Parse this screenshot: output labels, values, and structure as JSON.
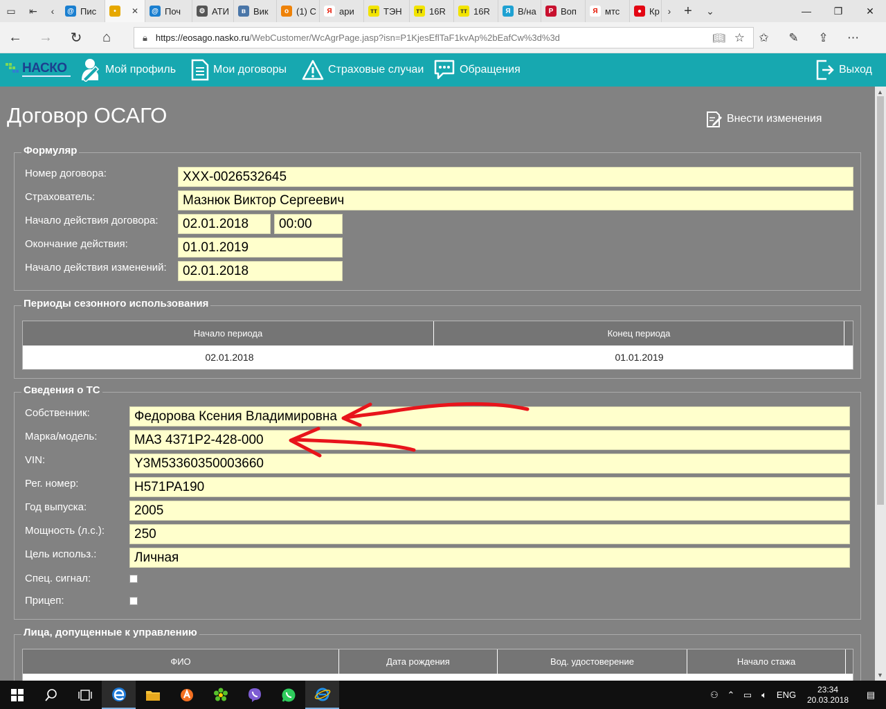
{
  "browser": {
    "tabs": [
      {
        "label": "Пис",
        "color": "#1a7fd0",
        "glyph": "@"
      },
      {
        "label": "",
        "color": "#e6a800",
        "glyph": "•",
        "active": true
      },
      {
        "label": "Поч",
        "color": "#1a7fd0",
        "glyph": "@"
      },
      {
        "label": "АТИ",
        "color": "#555555",
        "glyph": "⚙"
      },
      {
        "label": "Вик",
        "color": "#4a76a8",
        "glyph": "в"
      },
      {
        "label": "(1) С",
        "color": "#ee8208",
        "glyph": "о"
      },
      {
        "label": "ари",
        "color": "#ffffff",
        "glyph": "Я",
        "fg": "#e61400"
      },
      {
        "label": "ТЭН",
        "color": "#f2e400",
        "glyph": "тт",
        "fg": "#333"
      },
      {
        "label": "16R",
        "color": "#f2e400",
        "glyph": "тт",
        "fg": "#333"
      },
      {
        "label": "16R",
        "color": "#f2e400",
        "glyph": "тт",
        "fg": "#333"
      },
      {
        "label": "В/на",
        "color": "#1ea1d2",
        "glyph": "Я"
      },
      {
        "label": "Воп",
        "color": "#c8102e",
        "glyph": "Р"
      },
      {
        "label": "мтс",
        "color": "#ffffff",
        "glyph": "Я",
        "fg": "#e61400"
      },
      {
        "label": "Кр",
        "color": "#e30613",
        "glyph": "●"
      }
    ],
    "url_host": "https://eosago.nasko.ru",
    "url_path": "/WebCustomer/WcAgrPage.jasp?isn=P1KjesEflTaF1kvAp%2bEafCw%3d%3d"
  },
  "header": {
    "logo": "НАСКО",
    "nav": [
      {
        "label": "Мой профиль"
      },
      {
        "label": "Мои договоры"
      },
      {
        "label": "Страховые случаи"
      },
      {
        "label": "Обращения"
      }
    ],
    "logout": "Выход"
  },
  "page": {
    "title": "Договор ОСАГО",
    "edit_button": "Внести изменения"
  },
  "formular": {
    "legend": "Формуляр",
    "contract_number_label": "Номер договора:",
    "contract_number": "XXX-0026532645",
    "insurer_label": "Страхователь:",
    "insurer": "Мазнюк Виктор Сергеевич",
    "start_label": "Начало действия договора:",
    "start_date": "02.01.2018",
    "start_time": "00:00",
    "end_label": "Окончание действия:",
    "end_date": "01.01.2019",
    "changes_label": "Начало действия изменений:",
    "changes_date": "02.01.2018"
  },
  "seasonal": {
    "legend": "Периоды сезонного использования",
    "columns": [
      "Начало периода",
      "Конец периода"
    ],
    "rows": [
      [
        "02.01.2018",
        "01.01.2019"
      ]
    ]
  },
  "vehicle": {
    "legend": "Сведения о ТС",
    "owner_label": "Собственник:",
    "owner": "Федорова Ксения Владимировна",
    "model_label": "Марка/модель:",
    "model": "МАЗ 4371Р2-428-000",
    "vin_label": "VIN:",
    "vin": "Y3M53360350003660",
    "reg_label": "Рег. номер:",
    "reg": "Н571РА190",
    "year_label": "Год выпуска:",
    "year": "2005",
    "power_label": "Мощность (л.с.):",
    "power": "250",
    "purpose_label": "Цель использ.:",
    "purpose": "Личная",
    "signal_label": "Спец. сигнал:",
    "trailer_label": "Прицеп:"
  },
  "drivers": {
    "legend": "Лица, допущенные к управлению",
    "columns": [
      "ФИО",
      "Дата рождения",
      "Вод. удостоверение",
      "Начало стажа"
    ]
  },
  "taskbar": {
    "lang": "ENG",
    "time": "23:34",
    "date": "20.03.2018"
  },
  "colors": {
    "header_bg": "#17a8b0",
    "page_bg": "#828282",
    "field_bg": "#ffffcc",
    "annotation": "#e8141b"
  }
}
